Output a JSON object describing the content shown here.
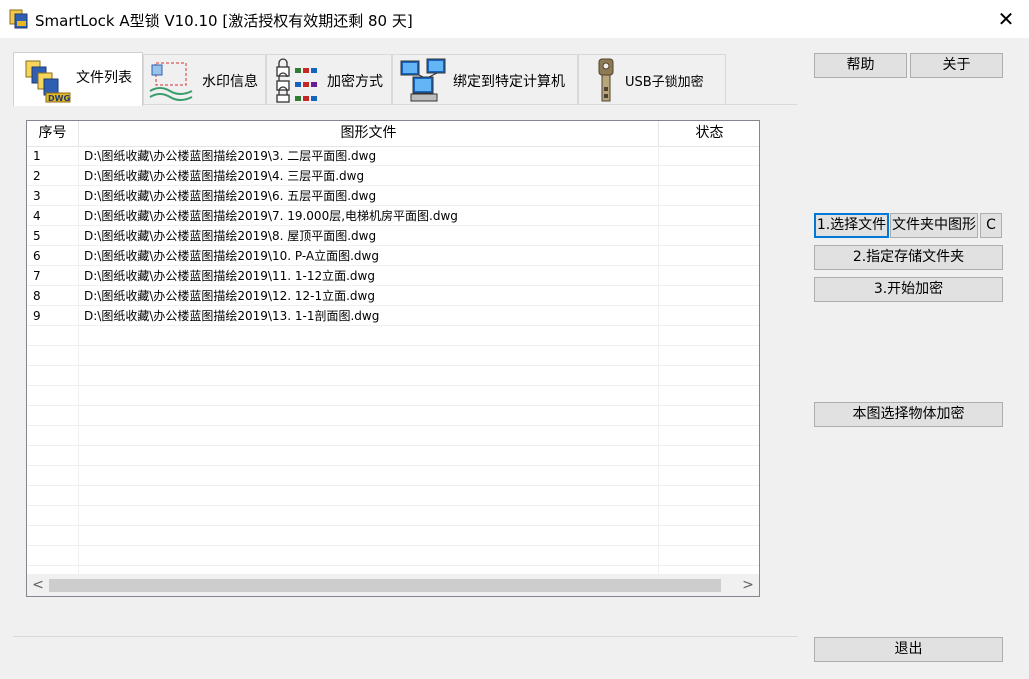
{
  "window": {
    "title": "SmartLock A型锁  V10.10 [激活授权有效期还剩 80 天]",
    "close_glyph": "✕"
  },
  "tabs": [
    {
      "label": "文件列表",
      "icon": "dwg-files-icon"
    },
    {
      "label": "水印信息",
      "icon": "watermark-icon"
    },
    {
      "label": "加密方式",
      "icon": "lock-icon"
    },
    {
      "label": "绑定到特定计算机",
      "icon": "computer-icon"
    },
    {
      "label": "USB子锁加密",
      "icon": "usb-key-icon"
    }
  ],
  "icon_badge": "DWG",
  "table": {
    "columns": [
      "序号",
      "图形文件",
      "状态"
    ],
    "rows": [
      {
        "no": "1",
        "file": "D:\\图纸收藏\\办公楼蓝图描绘2019\\3. 二层平面图.dwg",
        "status": ""
      },
      {
        "no": "2",
        "file": "D:\\图纸收藏\\办公楼蓝图描绘2019\\4. 三层平面.dwg",
        "status": ""
      },
      {
        "no": "3",
        "file": "D:\\图纸收藏\\办公楼蓝图描绘2019\\6. 五层平面图.dwg",
        "status": ""
      },
      {
        "no": "4",
        "file": "D:\\图纸收藏\\办公楼蓝图描绘2019\\7. 19.000层,电梯机房平面图.dwg",
        "status": ""
      },
      {
        "no": "5",
        "file": "D:\\图纸收藏\\办公楼蓝图描绘2019\\8. 屋顶平面图.dwg",
        "status": ""
      },
      {
        "no": "6",
        "file": "D:\\图纸收藏\\办公楼蓝图描绘2019\\10. P-A立面图.dwg",
        "status": ""
      },
      {
        "no": "7",
        "file": "D:\\图纸收藏\\办公楼蓝图描绘2019\\11. 1-12立面.dwg",
        "status": ""
      },
      {
        "no": "8",
        "file": "D:\\图纸收藏\\办公楼蓝图描绘2019\\12. 12-1立面.dwg",
        "status": ""
      },
      {
        "no": "9",
        "file": "D:\\图纸收藏\\办公楼蓝图描绘2019\\13. 1-1剖面图.dwg",
        "status": ""
      }
    ],
    "scroll_left": "<",
    "scroll_right": ">"
  },
  "buttons": {
    "help": "帮助",
    "about": "关于",
    "select_file": "1.选择文件",
    "folder_graphics": "文件夹中图形",
    "c": "C",
    "set_folder": "2.指定存储文件夹",
    "start_encrypt": "3.开始加密",
    "select_objects": "本图选择物体加密",
    "exit": "退出"
  },
  "colors": {
    "accent": "#0078d7",
    "button_bg": "#e1e1e1",
    "window_bg": "#f0f0f0"
  }
}
